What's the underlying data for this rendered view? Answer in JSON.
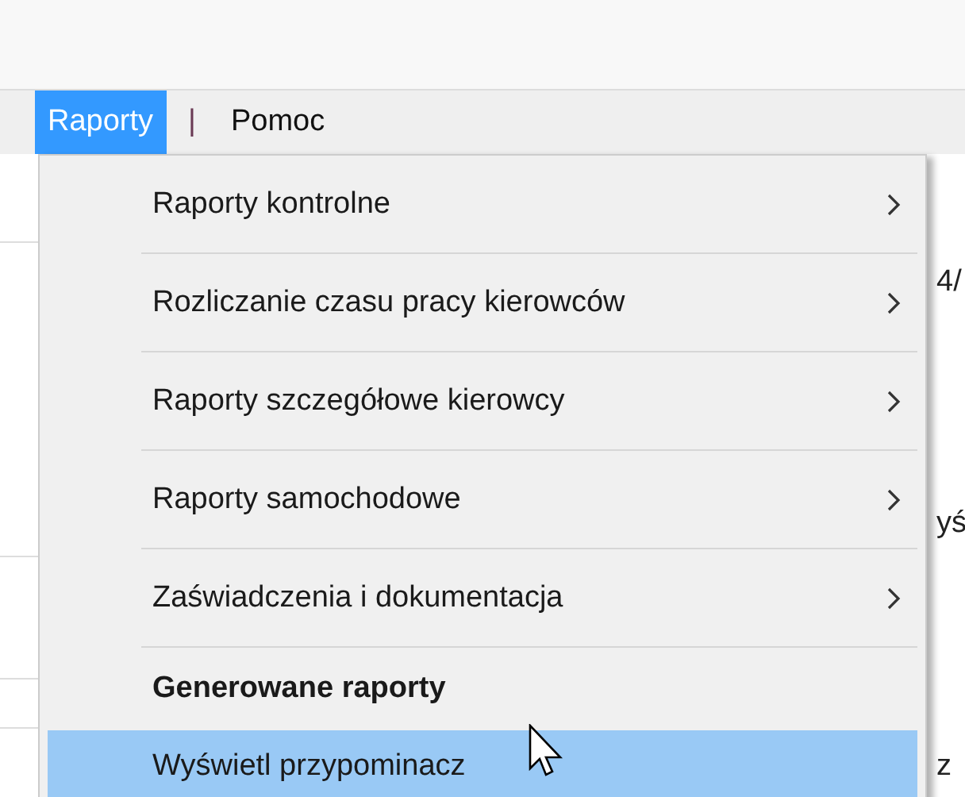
{
  "menubar": {
    "items": [
      {
        "label": "Raporty",
        "selected": true
      },
      {
        "label": "|",
        "kind": "separator"
      },
      {
        "label": "Pomoc",
        "selected": false
      }
    ]
  },
  "background_fragments": [
    "4/",
    "yś",
    "z"
  ],
  "dropdown": {
    "items": [
      {
        "label": "Raporty kontrolne",
        "kind": "submenu",
        "selected": false
      },
      {
        "label": "Rozliczanie czasu pracy kierowców",
        "kind": "submenu",
        "selected": false
      },
      {
        "label": "Raporty szczegółowe kierowcy",
        "kind": "submenu",
        "selected": false
      },
      {
        "label": "Raporty samochodowe",
        "kind": "submenu",
        "selected": false
      },
      {
        "label": "Zaświadczenia i dokumentacja",
        "kind": "submenu",
        "selected": false
      },
      {
        "label": "Generowane raporty",
        "kind": "header",
        "selected": false
      },
      {
        "label": "Wyświetl przypominacz",
        "kind": "action",
        "selected": true
      }
    ]
  }
}
